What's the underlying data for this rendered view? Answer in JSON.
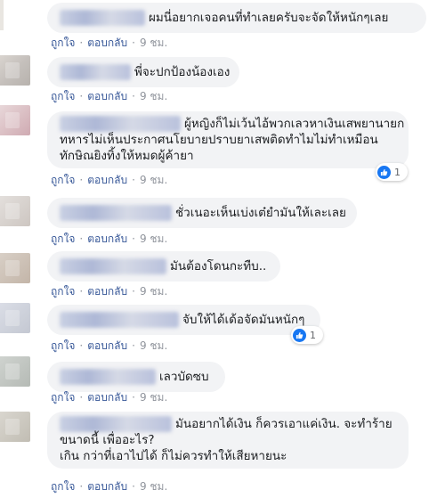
{
  "comments": [
    {
      "text": "ผมนี่อยากเจอคนที่ทำเลยครับจะจัดให้หนักๆเลย",
      "lines": [
        "ผมนี่อยากเจอคนที่ทำเลยครับจะจัดให้หนักๆเลย"
      ],
      "time": "9 ชม.",
      "reactions": null
    },
    {
      "text": "พี่จะปกป้องน้องเอง",
      "lines": [
        "พี่จะปกป้องน้องเอง"
      ],
      "time": "9 ชม.",
      "reactions": null
    },
    {
      "lines": [
        "ผู้หญิงก็ไม่เว้นไอ้พวกเลวหาเงินเสพยานายก",
        "ทหารไม่เห็นประกาศนโยบายปราบยาเสพติดทำไมไม่ทำเหมือน",
        "ทักษิณยิงทิ้งให้หมดผู้ค้ายา"
      ],
      "time": "9 ชม.",
      "reactions": "1"
    },
    {
      "lines": [
        "ชั่วเนอะเห็นเบ่งเต๋ยำมันให้เละเลย"
      ],
      "time": "9 ชม.",
      "reactions": null
    },
    {
      "lines": [
        "มันต้องโดนกะทืบ.."
      ],
      "time": "9 ชม.",
      "reactions": null
    },
    {
      "lines": [
        "จับให้ได้เด้อจัดมันหนักๆ"
      ],
      "time": "9 ชม.",
      "reactions": "1"
    },
    {
      "lines": [
        "เลวบัดซบ"
      ],
      "time": "9 ชม.",
      "reactions": null
    },
    {
      "lines": [
        "มันอยากได้เงิน ก็ควรเอาแค่เงิน. จะทำร้าย",
        "ขนาดนี้ เพื่ออะไร?",
        "เกิน กว่าที่เอาไปได้ ก็ไม่ควรทำให้เสียหายนะ"
      ],
      "time": "9 ชม.",
      "reactions": null
    }
  ],
  "actions": {
    "like": "ถูกใจ",
    "reply": "ตอบกลับ"
  },
  "colors": {
    "link": "#385898",
    "bubble": "#f2f3f5",
    "like_blue": "#1877f2"
  }
}
